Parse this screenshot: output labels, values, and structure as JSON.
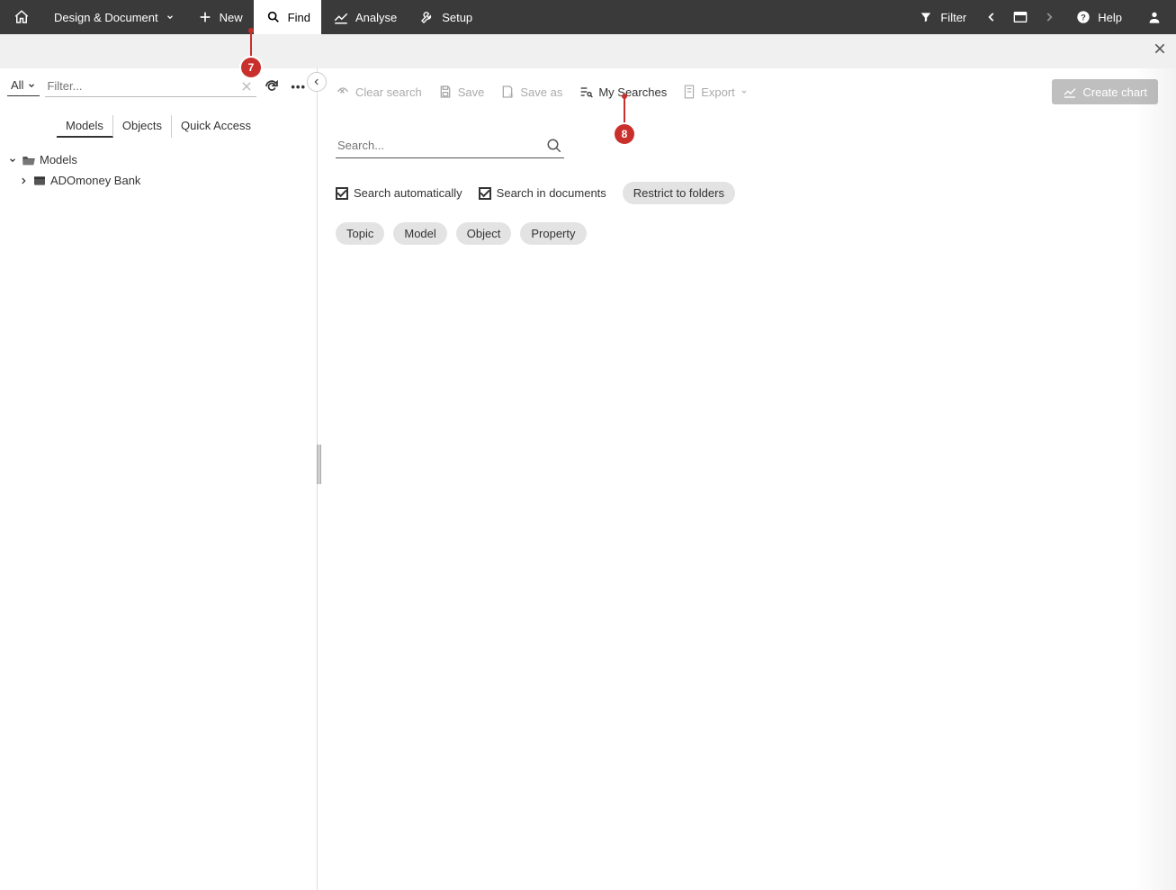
{
  "topnav": {
    "design_document": "Design & Document",
    "new": "New",
    "find": "Find",
    "analyse": "Analyse",
    "setup": "Setup",
    "filter": "Filter",
    "help": "Help"
  },
  "sidebar": {
    "type_select": "All",
    "filter_placeholder": "Filter...",
    "tabs": {
      "models": "Models",
      "objects": "Objects",
      "quick_access": "Quick Access"
    },
    "tree": {
      "root": "Models",
      "child1": "ADOmoney Bank"
    }
  },
  "toolbar": {
    "clear": "Clear search",
    "save": "Save",
    "save_as": "Save as",
    "my_searches": "My Searches",
    "export": "Export",
    "create_chart": "Create chart"
  },
  "search": {
    "placeholder": "Search...",
    "auto": "Search automatically",
    "in_docs": "Search in documents",
    "restrict": "Restrict to folders",
    "pills": {
      "topic": "Topic",
      "model": "Model",
      "object": "Object",
      "property": "Property"
    }
  },
  "annotations": {
    "a7": "7",
    "a8": "8"
  }
}
